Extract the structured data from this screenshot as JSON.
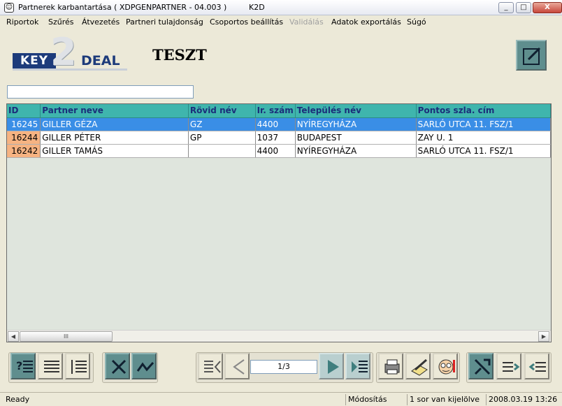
{
  "window": {
    "title": "Partnerek karbantartása ( XDPGENPARTNER - 04.003 )",
    "app": "K2D",
    "minimize": "_",
    "maximize": "□",
    "close": "X"
  },
  "menu": [
    {
      "label": "Riportok",
      "disabled": false
    },
    {
      "label": "Szűrés",
      "disabled": false
    },
    {
      "label": "Átvezetés",
      "disabled": false
    },
    {
      "label": "Partneri tulajdonság",
      "disabled": false
    },
    {
      "label": "Csoportos beállítás",
      "disabled": false
    },
    {
      "label": "Validálás",
      "disabled": true
    },
    {
      "label": "Adatok exportálás",
      "disabled": false
    },
    {
      "label": "Súgó",
      "disabled": false
    }
  ],
  "logo": {
    "key": "KEY",
    "two": "2",
    "deal": "DEAL"
  },
  "page_title": "TESZT",
  "search": {
    "value": "",
    "placeholder": ""
  },
  "table": {
    "columns": [
      "ID",
      "Partner neve",
      "Rövid név",
      "Ir. szám",
      "Település név",
      "Pontos szla. cím"
    ],
    "rows": [
      {
        "id": "16245",
        "name": "GILLER GÉZA",
        "short": "GZ",
        "zip": "4400",
        "city": "NYÍREGYHÁZA",
        "address": "SARLÓ UTCA 11. FSZ/1",
        "selected": true
      },
      {
        "id": "16244",
        "name": "GILLER PÉTER",
        "short": "GP",
        "zip": "1037",
        "city": "BUDAPEST",
        "address": "ZAY U. 1",
        "selected": false
      },
      {
        "id": "16242",
        "name": "GILLER TAMÁS",
        "short": "",
        "zip": "4400",
        "city": "NYÍREGYHÁZA",
        "address": "SARLÓ UTCA 11. FSZ/1",
        "selected": false
      }
    ]
  },
  "scrollbar": {
    "left": "◀",
    "right": "▶",
    "thumb": "III"
  },
  "pager": {
    "text": "1/3"
  },
  "status": {
    "ready": "Ready",
    "mode": "Módosítás",
    "selection": "1 sor van kijelölve",
    "datetime": "2008.03.19 13:26"
  },
  "colors": {
    "accent": "#3fb5ad",
    "selection": "#3a8ee6",
    "toolbar_teal": "#5f8e8e"
  }
}
